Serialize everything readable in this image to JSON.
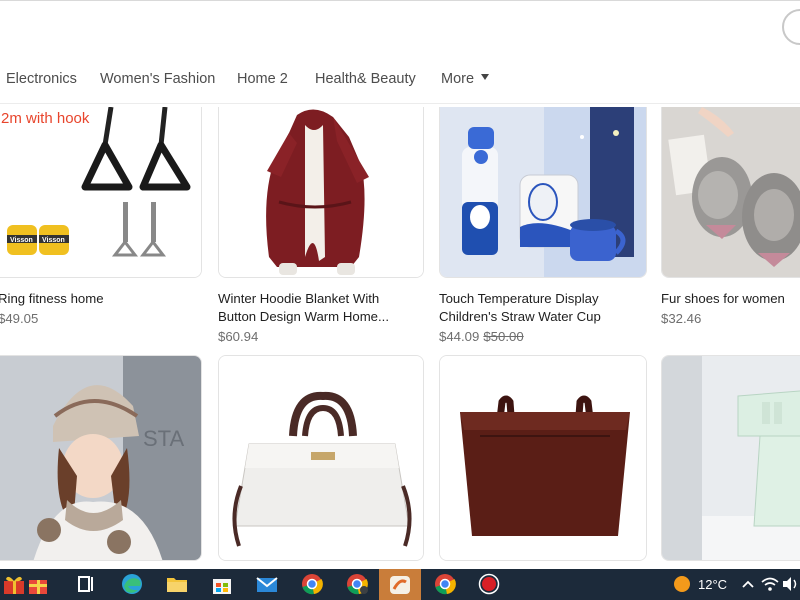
{
  "nav": {
    "categories": [
      "Electronics",
      "Women's Fashion",
      "Home 2",
      "Health& Beauty",
      "More"
    ]
  },
  "products": [
    {
      "title": "Ring fitness home",
      "price": "$49.05",
      "overlay": "2m with hook",
      "brand_tag": "Visson"
    },
    {
      "title": "Winter Hoodie Blanket With",
      "title2": "Button Design Warm Home...",
      "price": "$60.94"
    },
    {
      "title": "Touch Temperature Display",
      "title2": "Children's Straw Water Cup",
      "price": "$44.09",
      "old_price": "$50.00"
    },
    {
      "title": "Fur shoes for women",
      "price": "$32.46"
    },
    {
      "title": ""
    },
    {
      "title": ""
    },
    {
      "title": ""
    },
    {
      "title": ""
    }
  ],
  "taskbar": {
    "icons": [
      "gift-icon",
      "task-view-icon",
      "edge-icon",
      "file-explorer-icon",
      "store-icon",
      "mail-icon",
      "chrome-icon",
      "chrome-profile-icon",
      "app-icon",
      "chrome-icon-2",
      "record-icon"
    ],
    "temperature": "12°C"
  },
  "colors": {
    "accent_red": "#e8452c",
    "taskbar": "#1c2a3a"
  }
}
